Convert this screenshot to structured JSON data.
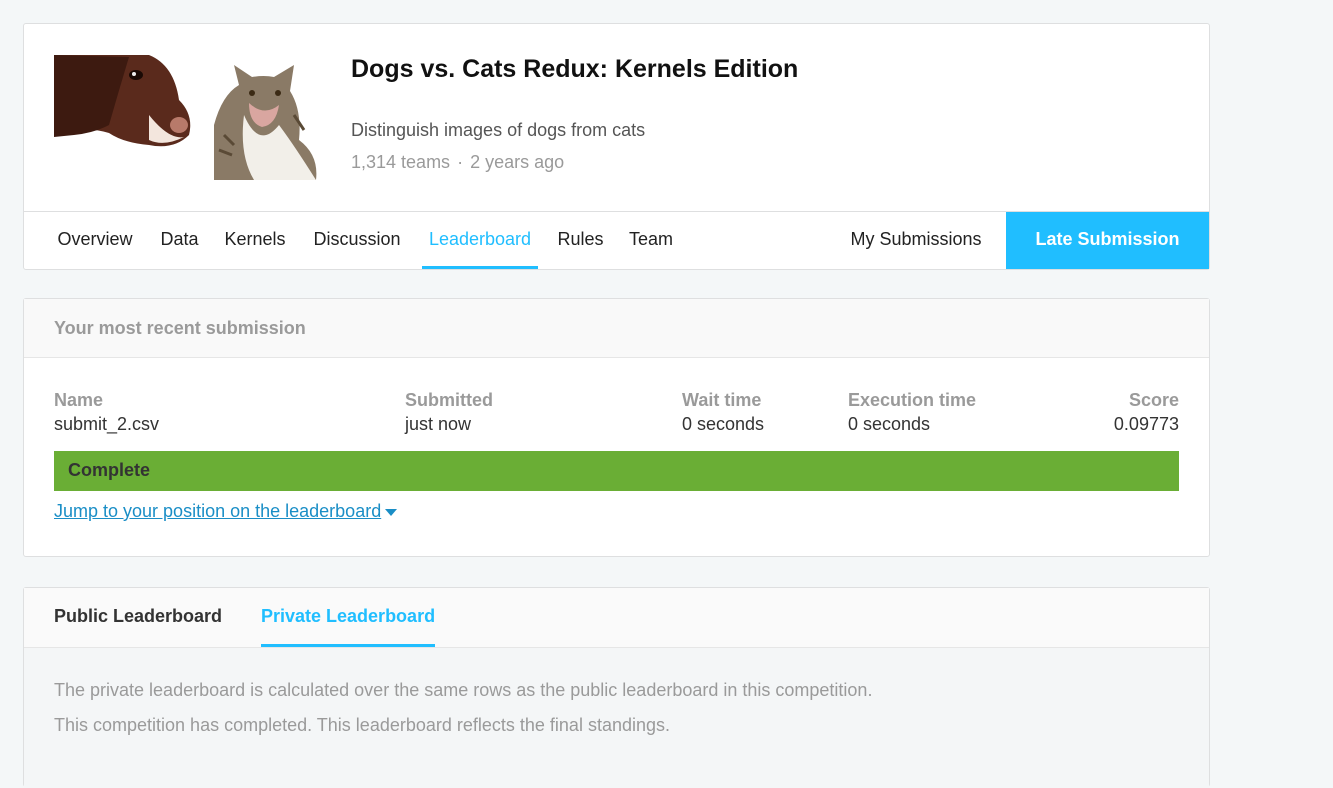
{
  "competition": {
    "title": "Dogs vs. Cats Redux: Kernels Edition",
    "subtitle": "Distinguish images of dogs from cats",
    "teams": "1,314 teams",
    "separator": "·",
    "age": "2 years ago"
  },
  "nav": {
    "items": [
      {
        "label": "Overview"
      },
      {
        "label": "Data"
      },
      {
        "label": "Kernels"
      },
      {
        "label": "Discussion"
      },
      {
        "label": "Leaderboard"
      },
      {
        "label": "Rules"
      },
      {
        "label": "Team"
      }
    ],
    "active": "Leaderboard",
    "my_submissions": "My Submissions",
    "late_submission": "Late Submission"
  },
  "submission": {
    "header": "Your most recent submission",
    "columns": [
      {
        "label": "Name",
        "value": "submit_2.csv"
      },
      {
        "label": "Submitted",
        "value": "just now"
      },
      {
        "label": "Wait time",
        "value": "0 seconds"
      },
      {
        "label": "Execution time",
        "value": "0 seconds"
      },
      {
        "label": "Score",
        "value": "0.09773"
      }
    ],
    "status": "Complete",
    "jump_link": "Jump to your position on the leaderboard"
  },
  "leaderboard": {
    "tabs": [
      {
        "label": "Public Leaderboard"
      },
      {
        "label": "Private Leaderboard"
      }
    ],
    "active_tab": "Private Leaderboard",
    "notes": [
      "The private leaderboard is calculated over the same rows as the public leaderboard in this competition.",
      "This competition has completed. This leaderboard reflects the final standings."
    ]
  },
  "colors": {
    "accent": "#20beff",
    "status_complete": "#6aae35",
    "link": "#1a8ec6"
  }
}
